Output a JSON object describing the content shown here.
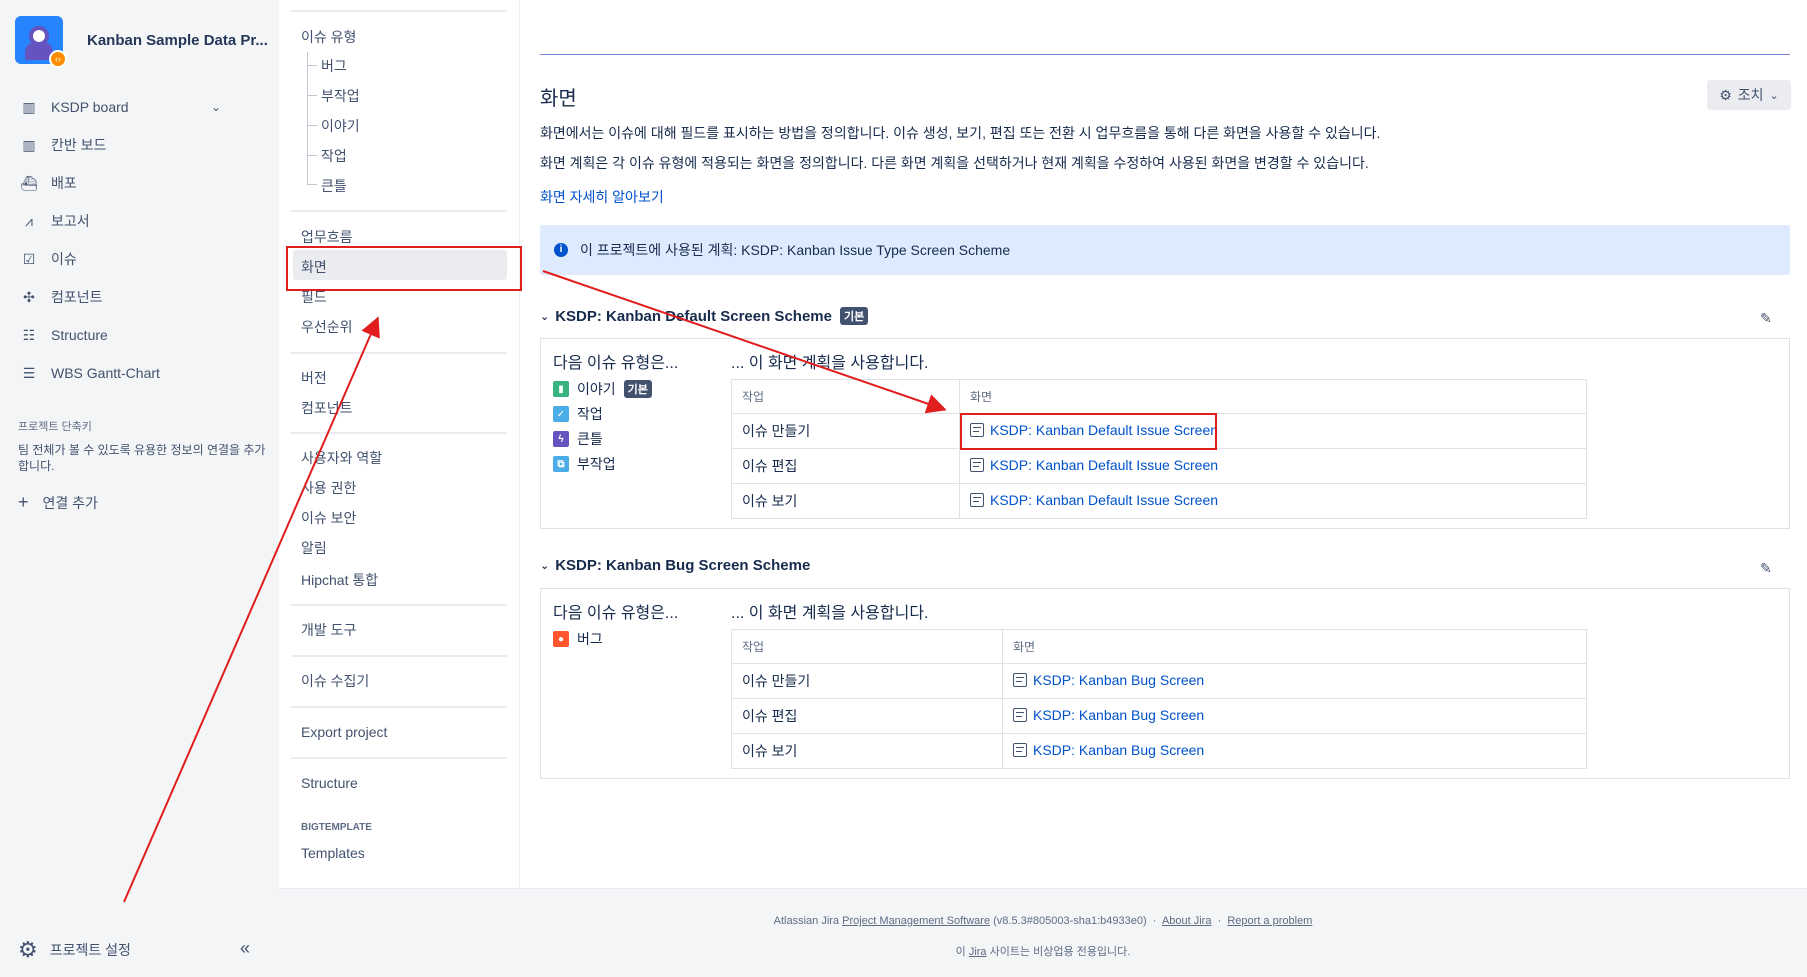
{
  "sidebar": {
    "project_name": "Kanban Sample Data Pr...",
    "items": [
      {
        "label": "KSDP board",
        "icon": "board-icon"
      },
      {
        "label": "칸반 보드",
        "icon": "columns-icon"
      },
      {
        "label": "배포",
        "icon": "ship-icon"
      },
      {
        "label": "보고서",
        "icon": "chart-icon"
      },
      {
        "label": "이슈",
        "icon": "issues-icon"
      },
      {
        "label": "컴포넌트",
        "icon": "puzzle-icon"
      },
      {
        "label": "Structure",
        "icon": "structure-icon"
      },
      {
        "label": "WBS Gantt-Chart",
        "icon": "gantt-icon"
      }
    ],
    "shortcuts_title": "프로젝트 단축키",
    "shortcuts_desc": "팀 전체가 볼 수 있도록 유용한 정보의 연결을 추가합니다.",
    "add_link": "연결 추가",
    "project_settings": "프로젝트 설정"
  },
  "settings_nav": {
    "issue_types": "이슈 유형",
    "issue_type_children": [
      "버그",
      "부작업",
      "이야기",
      "작업",
      "큰틀"
    ],
    "workflows": "업무흐름",
    "screens": "화면",
    "fields": "필드",
    "priorities": "우선순위",
    "versions": "버전",
    "components": "컴포넌트",
    "users_roles": "사용자와 역할",
    "permissions": "사용 권한",
    "issue_security": "이슈 보안",
    "notifications": "알림",
    "hipchat": "Hipchat 통합",
    "dev_tools": "개발 도구",
    "issue_collectors": "이슈 수집기",
    "export_project": "Export project",
    "structure": "Structure",
    "bigtemplate_header": "BIGTEMPLATE",
    "templates": "Templates"
  },
  "main": {
    "title": "화면",
    "actions_label": "조치",
    "desc1": "화면에서는 이슈에 대해 필드를 표시하는 방법을 정의합니다. 이슈 생성, 보기, 편집 또는 전환 시 업무흐름을 통해 다른 화면을 사용할 수 있습니다.",
    "desc2": "화면 계획은 각 이슈 유형에 적용되는 화면을 정의합니다. 다른 화면 계획을 선택하거나 현재 계획을 수정하여 사용된 화면을 변경할 수 있습니다.",
    "learn_more": "화면 자세히 알아보기",
    "info": "이 프로젝트에 사용된 계획: KSDP: Kanban Issue Type Screen Scheme",
    "col_issue_types": "다음 이슈 유형은...",
    "col_uses": "... 이 화면 계획을 사용합니다.",
    "th_operation": "작업",
    "th_screen": "화면",
    "schemes": [
      {
        "name": "KSDP: Kanban Default Screen Scheme",
        "badge": "기본",
        "issue_types": [
          {
            "label": "이야기",
            "badge": "기본",
            "color": "#36b37e",
            "icon": "story-icon"
          },
          {
            "label": "작업",
            "badge": "",
            "color": "#4bade8",
            "icon": "task-icon"
          },
          {
            "label": "큰틀",
            "badge": "",
            "color": "#6554c0",
            "icon": "epic-icon"
          },
          {
            "label": "부작업",
            "badge": "",
            "color": "#4bade8",
            "icon": "subtask-icon"
          }
        ],
        "rows": [
          {
            "op": "이슈 만들기",
            "screen": "KSDP: Kanban Default Issue Screen"
          },
          {
            "op": "이슈 편집",
            "screen": "KSDP: Kanban Default Issue Screen"
          },
          {
            "op": "이슈 보기",
            "screen": "KSDP: Kanban Default Issue Screen"
          }
        ]
      },
      {
        "name": "KSDP: Kanban Bug Screen Scheme",
        "badge": "",
        "issue_types": [
          {
            "label": "버그",
            "badge": "",
            "color": "#ff5630",
            "icon": "bug-icon"
          }
        ],
        "rows": [
          {
            "op": "이슈 만들기",
            "screen": "KSDP: Kanban Bug Screen"
          },
          {
            "op": "이슈 편집",
            "screen": "KSDP: Kanban Bug Screen"
          },
          {
            "op": "이슈 보기",
            "screen": "KSDP: Kanban Bug Screen"
          }
        ]
      }
    ]
  },
  "footer": {
    "line1_prefix": "Atlassian Jira",
    "line1_link": "Project Management Software",
    "line1_version": "(v8.5.3#805003-sha1:b4933e0)",
    "about": "About Jira",
    "report": "Report a problem",
    "line2_prefix": "이",
    "line2_link": "Jira",
    "line2_suffix": "사이트는 비상업용 전용입니다."
  },
  "colors": {
    "accent": "#0052cc",
    "annotation": "#e01e1e"
  }
}
